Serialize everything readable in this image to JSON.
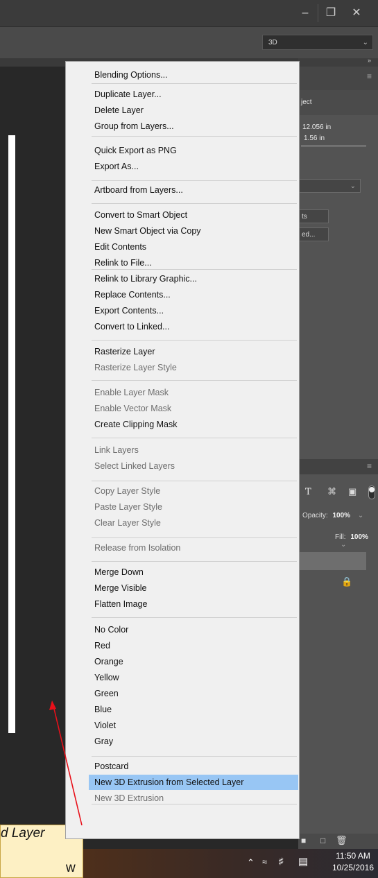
{
  "window": {
    "minimize_glyph": "–",
    "restore_glyph": "❐",
    "close_glyph": "✕"
  },
  "workspace": {
    "selected": "3D"
  },
  "panels": {
    "properties_title_fragment": "ject",
    "width_value": "12.056 in",
    "height_value": "1.56 in",
    "btn1_fragment": "ts",
    "btn2_fragment": "ed...",
    "opacity_label": "Opacity:",
    "opacity_value": "100%",
    "fill_label": "Fill:",
    "fill_value": "100%"
  },
  "menu": {
    "items": [
      {
        "label": "Blending Options...",
        "enabled": true
      },
      {
        "label": "Duplicate Layer...",
        "enabled": true
      },
      {
        "label": "Delete Layer",
        "enabled": true
      },
      {
        "label": "Group from Layers...",
        "enabled": true
      },
      {
        "label": "Quick Export as PNG",
        "enabled": true
      },
      {
        "label": "Export As...",
        "enabled": true
      },
      {
        "label": "Artboard from Layers...",
        "enabled": true
      },
      {
        "label": "Convert to Smart Object",
        "enabled": true
      },
      {
        "label": "New Smart Object via Copy",
        "enabled": true
      },
      {
        "label": "Edit Contents",
        "enabled": true
      },
      {
        "label": "Relink to File...",
        "enabled": true
      },
      {
        "label": "Relink to Library Graphic...",
        "enabled": true
      },
      {
        "label": "Replace Contents...",
        "enabled": true
      },
      {
        "label": "Export Contents...",
        "enabled": true
      },
      {
        "label": "Convert to Linked...",
        "enabled": true
      },
      {
        "label": "Rasterize Layer",
        "enabled": true
      },
      {
        "label": "Rasterize Layer Style",
        "enabled": false
      },
      {
        "label": "Enable Layer Mask",
        "enabled": false
      },
      {
        "label": "Enable Vector Mask",
        "enabled": false
      },
      {
        "label": "Create Clipping Mask",
        "enabled": true
      },
      {
        "label": "Link Layers",
        "enabled": false
      },
      {
        "label": "Select Linked Layers",
        "enabled": false
      },
      {
        "label": "Copy Layer Style",
        "enabled": false
      },
      {
        "label": "Paste Layer Style",
        "enabled": false
      },
      {
        "label": "Clear Layer Style",
        "enabled": false
      },
      {
        "label": "Release from Isolation",
        "enabled": false
      },
      {
        "label": "Merge Down",
        "enabled": true
      },
      {
        "label": "Merge Visible",
        "enabled": true
      },
      {
        "label": "Flatten Image",
        "enabled": true
      },
      {
        "label": "No Color",
        "enabled": true
      },
      {
        "label": "Red",
        "enabled": true
      },
      {
        "label": "Orange",
        "enabled": true
      },
      {
        "label": "Yellow",
        "enabled": true
      },
      {
        "label": "Green",
        "enabled": true
      },
      {
        "label": "Blue",
        "enabled": true
      },
      {
        "label": "Violet",
        "enabled": true
      },
      {
        "label": "Gray",
        "enabled": true
      },
      {
        "label": "Postcard",
        "enabled": true
      },
      {
        "label": "New 3D Extrusion from Selected Layer",
        "enabled": true,
        "highlighted": true
      },
      {
        "label": "New 3D Extrusion",
        "enabled": false
      }
    ]
  },
  "callout": {
    "line1": "d Layer",
    "line2": "w"
  },
  "taskbar": {
    "time": "11:50 AM",
    "date": "10/25/2016"
  },
  "colors": {
    "highlight": "#98c6f4",
    "arrow": "#e8101a",
    "callout_bg": "#fdf0c4"
  }
}
